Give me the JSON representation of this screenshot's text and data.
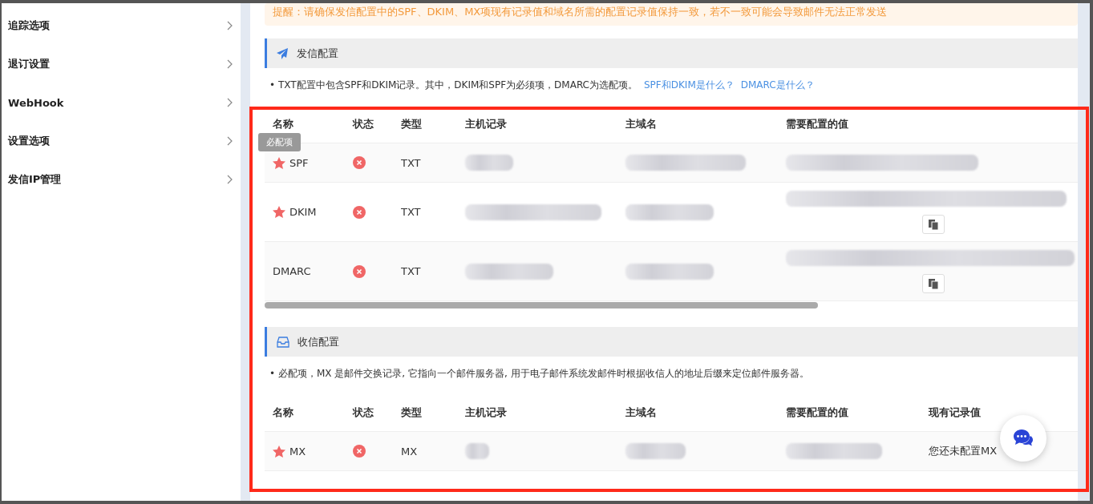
{
  "sidebar": {
    "items": [
      {
        "label": "追踪选项"
      },
      {
        "label": "退订设置"
      },
      {
        "label": "WebHook"
      },
      {
        "label": "设置选项"
      },
      {
        "label": "发信IP管理"
      }
    ]
  },
  "notice": "提醒：请确保发信配置中的SPF、DKIM、MX项现有记录值和域名所需的配置记录值保持一致，若不一致可能会导致邮件无法正常发送",
  "sections": [
    {
      "title": "发信配置",
      "note": "• TXT配置中包含SPF和DKIM记录。其中，DKIM和SPF为必须项，DMARC为选配项。",
      "links": [
        "SPF和DKIM是什么？",
        "DMARC是什么？"
      ],
      "tooltip": "必配项",
      "scrollbar": true,
      "columns": [
        "名称",
        "状态",
        "类型",
        "主机记录",
        "主域名",
        "需要配置的值"
      ],
      "rows": [
        {
          "name": "SPF",
          "required": true,
          "verified": false,
          "type": "TXT"
        },
        {
          "name": "DKIM",
          "required": true,
          "verified": false,
          "type": "TXT",
          "copy_button": true
        },
        {
          "name": "DMARC",
          "required": false,
          "verified": false,
          "type": "TXT",
          "copy_button": true
        }
      ]
    },
    {
      "title": "收信配置",
      "note": "• 必配项，MX 是邮件交换记录, 它指向一个邮件服务器, 用于电子邮件系统发邮件时根据收信人的地址后缀来定位邮件服务器。",
      "columns": [
        "名称",
        "状态",
        "类型",
        "主机记录",
        "主域名",
        "需要配置的值",
        "现有记录值"
      ],
      "rows": [
        {
          "name": "MX",
          "required": true,
          "verified": false,
          "type": "MX",
          "existing": "您还未配置MX"
        }
      ]
    }
  ]
}
